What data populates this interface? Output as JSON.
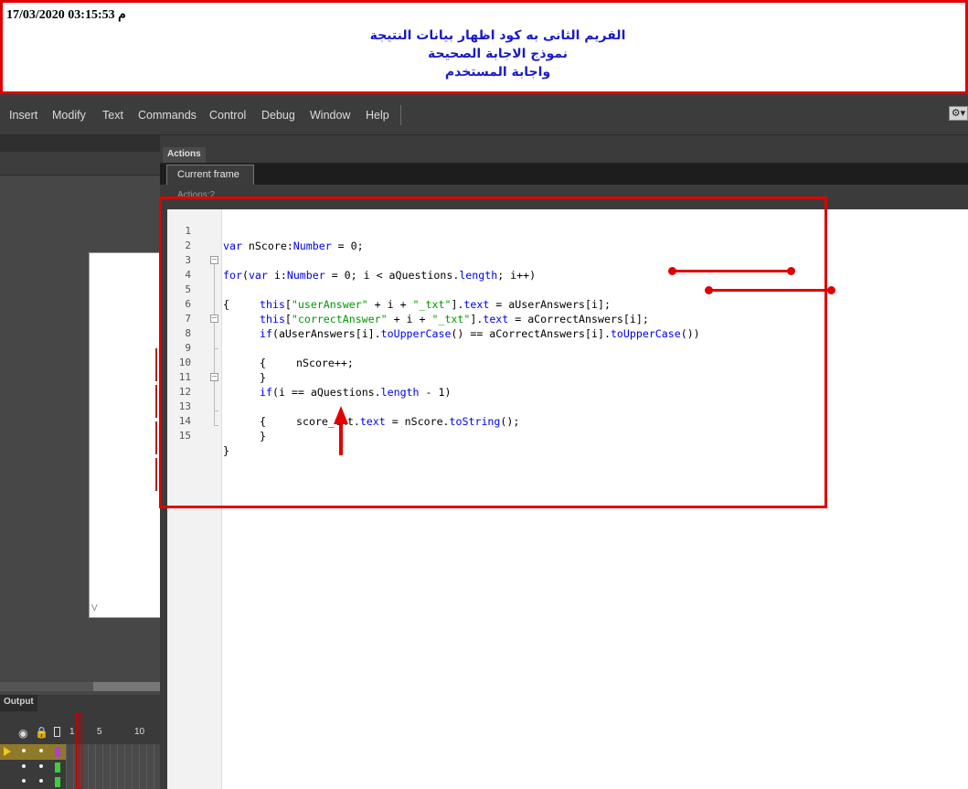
{
  "annotation": {
    "timestamp": "17/03/2020 03:15:53 م",
    "lines": [
      "الفريم الثانى به كود اظهار بيانات النتيجة",
      "نموذج الاجابة الصحيحة",
      "واجابة المستخدم"
    ]
  },
  "menu": {
    "items": [
      "Insert",
      "Modify",
      "Text",
      "Commands",
      "Control",
      "Debug",
      "Window",
      "Help"
    ]
  },
  "toolbar": {
    "gear_icon": "gear-icon"
  },
  "stage": {
    "corner_label": "V"
  },
  "output": {
    "tab_label": "Output",
    "frame_numbers": [
      "1",
      "5",
      "10"
    ]
  },
  "actions": {
    "panel_tab": "Actions",
    "current_frame_tab": "Current frame",
    "sub_label": "Actions:2"
  },
  "code": {
    "line_numbers": [
      "1",
      "2",
      "3",
      "4",
      "5",
      "6",
      "7",
      "8",
      "9",
      "10",
      "11",
      "12",
      "13",
      "14",
      "15"
    ],
    "lines": [
      "var nScore:Number = 0;",
      "",
      "for(var i:Number = 0; i < aQuestions.length; i++)",
      "{",
      "this[\"userAnswer\" + i + \"_txt\"].text = aUserAnswers[i];",
      "this[\"correctAnswer\" + i + \"_txt\"].text = aCorrectAnswers[i];",
      "if(aUserAnswers[i].toUpperCase() == aCorrectAnswers[i].toUpperCase())",
      "{",
      "nScore++;",
      "}",
      "if(i == aQuestions.length - 1)",
      "{",
      "score_txt.text = nScore.toString();",
      "}",
      "}"
    ]
  },
  "colors": {
    "annotation_red": "#e00000",
    "annotation_text_blue": "#1a1ac8",
    "keyword_blue": "#0000ee",
    "string_green": "#009900"
  }
}
